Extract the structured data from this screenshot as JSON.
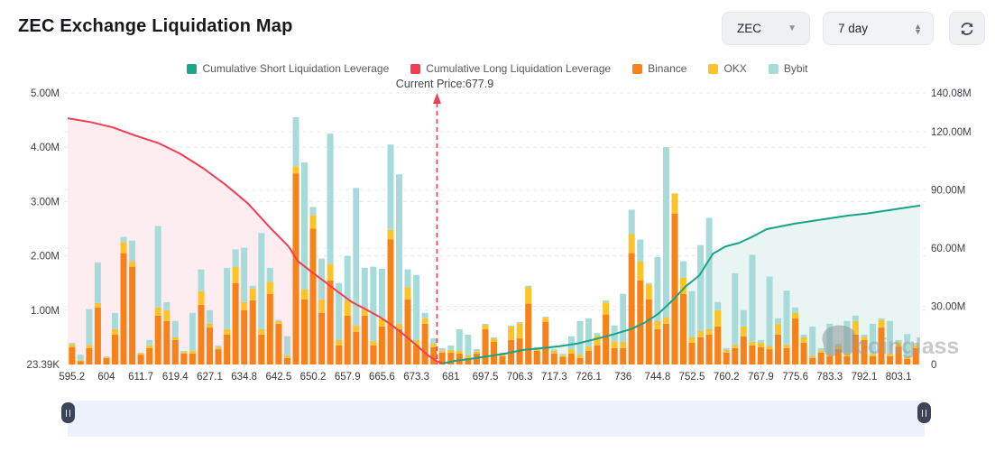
{
  "header": {
    "title": "ZEC Exchange Liquidation Map"
  },
  "controls": {
    "symbol_select": {
      "value": "ZEC",
      "caret": "▼"
    },
    "period_select": {
      "value": "7 day",
      "up": "▲",
      "down": "▼"
    },
    "refresh_label": "refresh"
  },
  "legend": [
    {
      "label": "Cumulative Short Liquidation Leverage",
      "color": "#1fa38b"
    },
    {
      "label": "Cumulative Long Liquidation Leverage",
      "color": "#f23d53"
    },
    {
      "label": "Binance",
      "color": "#f8821a"
    },
    {
      "label": "OKX",
      "color": "#fdc42a"
    },
    {
      "label": "Bybit",
      "color": "#a6dbd9"
    }
  ],
  "annotation": {
    "current_price_label": "Current Price:677.9",
    "current_price": 677.9
  },
  "watermark": {
    "text": "coinglass"
  },
  "chart_data": {
    "type": "bar",
    "subtype": "stacked-bars-with-cumulative-lines",
    "x_tick_labels": [
      "595.2",
      "604",
      "611.7",
      "619.4",
      "627.1",
      "634.8",
      "642.5",
      "650.2",
      "657.9",
      "665.6",
      "673.3",
      "681",
      "697.5",
      "706.3",
      "717.3",
      "726.1",
      "736",
      "744.8",
      "752.5",
      "760.2",
      "767.9",
      "775.6",
      "783.3",
      "792.1",
      "803.1"
    ],
    "bars_per_tick": 4,
    "bar_count": 99,
    "left_axis": {
      "unit": "M",
      "tick_labels": [
        "5.00M",
        "4.00M",
        "3.00M",
        "2.00M",
        "1.00M",
        "23.39K"
      ],
      "tick_values": [
        5,
        4,
        3,
        2,
        1,
        0.02339
      ],
      "max": 5.0
    },
    "right_axis": {
      "unit": "M",
      "tick_labels": [
        "140.08M",
        "120.00M",
        "90.00M",
        "60.00M",
        "30.00M",
        "0"
      ],
      "tick_values": [
        140.08,
        120,
        90,
        60,
        30,
        0
      ],
      "max": 140.08
    },
    "grid": true,
    "legend_position": "top-center",
    "series": [
      {
        "name": "Binance",
        "color": "#f8821a",
        "values": [
          0.32,
          0.06,
          0.3,
          1.05,
          0.12,
          0.55,
          2.05,
          1.8,
          0.18,
          0.3,
          0.9,
          0.8,
          0.45,
          0.2,
          0.2,
          1.1,
          0.68,
          0.28,
          0.55,
          1.5,
          1.0,
          1.18,
          0.55,
          1.3,
          0.75,
          0.12,
          3.52,
          1.2,
          2.5,
          0.95,
          1.55,
          0.35,
          0.9,
          0.6,
          0.9,
          0.35,
          0.7,
          2.3,
          0.65,
          1.2,
          0.35,
          0.75,
          0.32,
          0.22,
          0.22,
          0.2,
          0.12,
          0.2,
          0.65,
          0.42,
          0.15,
          0.45,
          0.48,
          1.12,
          0.25,
          0.78,
          0.2,
          0.14,
          0.2,
          0.12,
          0.25,
          0.35,
          0.92,
          0.3,
          0.3,
          2.05,
          1.55,
          1.2,
          0.65,
          0.75,
          2.78,
          1.3,
          0.4,
          0.5,
          0.55,
          0.7,
          0.22,
          0.3,
          0.52,
          0.35,
          0.32,
          0.28,
          0.55,
          0.3,
          0.85,
          0.4,
          0.12,
          0.22,
          0.15,
          0.28,
          0.15,
          0.55,
          0.45,
          0.15,
          0.68,
          0.15,
          0.33,
          0.1,
          0.3
        ]
      },
      {
        "name": "OKX",
        "color": "#fdc42a",
        "values": [
          0.05,
          0.02,
          0.06,
          0.08,
          0.02,
          0.1,
          0.2,
          0.1,
          0.03,
          0.05,
          0.15,
          0.2,
          0.05,
          0.03,
          0.05,
          0.25,
          0.07,
          0.04,
          0.1,
          0.3,
          0.15,
          0.22,
          0.1,
          0.22,
          0.05,
          0.05,
          0.13,
          0.18,
          0.25,
          0.25,
          0.3,
          0.1,
          0.28,
          0.12,
          0.12,
          0.08,
          0.15,
          0.18,
          0.1,
          0.22,
          0.1,
          0.1,
          0.06,
          0.04,
          0.05,
          0.05,
          0.05,
          0.04,
          0.08,
          0.06,
          0.04,
          0.25,
          0.28,
          0.3,
          0.04,
          0.08,
          0.05,
          0.03,
          0.08,
          0.06,
          0.08,
          0.18,
          0.22,
          0.12,
          0.12,
          0.35,
          0.35,
          0.27,
          0.15,
          0.12,
          0.37,
          0.3,
          0.1,
          0.12,
          0.1,
          0.3,
          0.05,
          0.06,
          0.18,
          0.07,
          0.08,
          0.06,
          0.2,
          0.06,
          0.1,
          0.1,
          0.04,
          0.04,
          0.04,
          0.06,
          0.05,
          0.25,
          0.06,
          0.04,
          0.14,
          0.05,
          0.08,
          0.04,
          0.06
        ]
      },
      {
        "name": "Bybit",
        "color": "#a6dbd9",
        "values": [
          0.03,
          0.1,
          0.66,
          0.75,
          0.01,
          0.3,
          0.1,
          0.38,
          0.01,
          0.1,
          1.5,
          0.15,
          0.3,
          0.02,
          0.7,
          0.4,
          0.25,
          0.03,
          1.13,
          0.32,
          1.0,
          0.05,
          1.77,
          0.26,
          0.02,
          0.35,
          0.9,
          2.34,
          0.15,
          0.75,
          2.4,
          1.05,
          0.82,
          2.53,
          0.76,
          1.37,
          0.91,
          1.57,
          2.75,
          0.33,
          1.2,
          0.1,
          0.1,
          0.04,
          0.08,
          0.4,
          0.38,
          0.04,
          0.02,
          0.02,
          0.03,
          0.02,
          0.02,
          0.03,
          0.03,
          0.02,
          0.03,
          0.03,
          0.24,
          0.62,
          0.52,
          0.05,
          0.04,
          0.3,
          0.88,
          0.45,
          0.4,
          0.03,
          1.18,
          3.13,
          0.0,
          0.3,
          0.85,
          1.58,
          2.05,
          0.15,
          0.03,
          1.32,
          0.3,
          1.6,
          0.05,
          1.28,
          0.1,
          1.0,
          0.1,
          0.05,
          0.54,
          0.04,
          0.56,
          0.04,
          0.6,
          0.1,
          0.04,
          0.56,
          0.03,
          0.6,
          0.04,
          0.42,
          0.04
        ]
      }
    ],
    "lines": [
      {
        "name": "Cumulative Long Liquidation Leverage",
        "color": "#f23d53",
        "fill": "#fdedf1",
        "axis": "right",
        "points": [
          [
            0.0,
            127.0
          ],
          [
            0.026,
            125.1
          ],
          [
            0.053,
            122.3
          ],
          [
            0.079,
            118.1
          ],
          [
            0.106,
            114.3
          ],
          [
            0.132,
            108.7
          ],
          [
            0.159,
            101.2
          ],
          [
            0.185,
            92.8
          ],
          [
            0.212,
            82.9
          ],
          [
            0.238,
            70.3
          ],
          [
            0.259,
            60.9
          ],
          [
            0.27,
            53.4
          ],
          [
            0.286,
            47.8
          ],
          [
            0.302,
            42.6
          ],
          [
            0.317,
            37.5
          ],
          [
            0.333,
            32.3
          ],
          [
            0.349,
            28.6
          ],
          [
            0.365,
            24.8
          ],
          [
            0.381,
            20.1
          ],
          [
            0.397,
            14.5
          ],
          [
            0.413,
            8.4
          ],
          [
            0.423,
            4.7
          ],
          [
            0.432,
            1.9
          ],
          [
            0.44,
            0.5
          ]
        ]
      },
      {
        "name": "Cumulative Short Liquidation Leverage",
        "color": "#17a38a",
        "fill": "#e8f5f2",
        "axis": "right",
        "points": [
          [
            0.44,
            0.5
          ],
          [
            0.455,
            1.9
          ],
          [
            0.471,
            2.8
          ],
          [
            0.492,
            4.2
          ],
          [
            0.513,
            5.6
          ],
          [
            0.534,
            7.5
          ],
          [
            0.556,
            8.4
          ],
          [
            0.577,
            9.4
          ],
          [
            0.598,
            10.8
          ],
          [
            0.619,
            13.1
          ],
          [
            0.64,
            15.5
          ],
          [
            0.661,
            18.3
          ],
          [
            0.677,
            21.6
          ],
          [
            0.693,
            26.2
          ],
          [
            0.709,
            32.8
          ],
          [
            0.725,
            40.3
          ],
          [
            0.741,
            45.9
          ],
          [
            0.757,
            57.2
          ],
          [
            0.772,
            60.9
          ],
          [
            0.788,
            62.8
          ],
          [
            0.804,
            66.1
          ],
          [
            0.82,
            69.8
          ],
          [
            0.836,
            71.2
          ],
          [
            0.852,
            72.6
          ],
          [
            0.873,
            74.0
          ],
          [
            0.894,
            75.4
          ],
          [
            0.915,
            76.8
          ],
          [
            0.937,
            77.8
          ],
          [
            0.958,
            79.2
          ],
          [
            0.979,
            80.6
          ],
          [
            1.0,
            82.0
          ]
        ]
      }
    ]
  }
}
